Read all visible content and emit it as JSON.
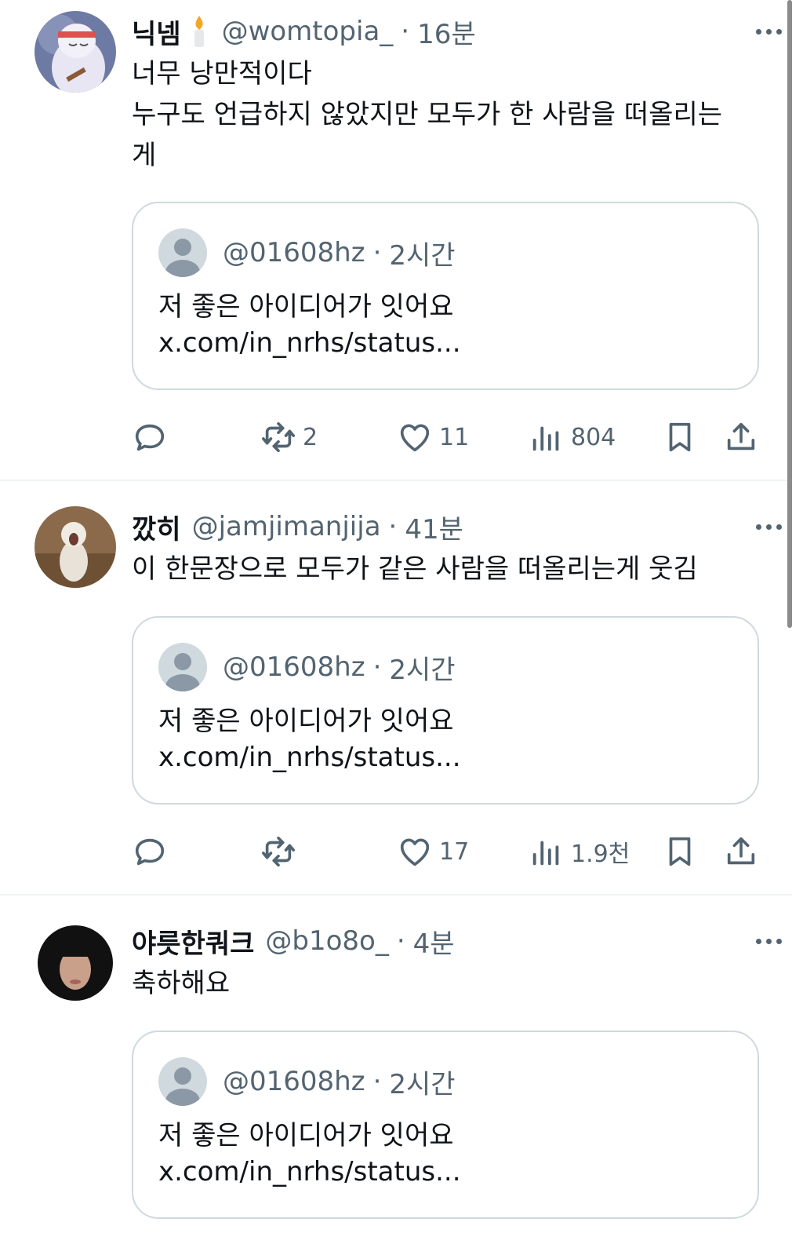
{
  "tweets": [
    {
      "name": "닉넴",
      "handle": "@womtopia_",
      "time": "16분",
      "text_lines": [
        "너무 낭만적이다",
        "누구도 언급하지 않았지만 모두가 한 사람을 떠올리는",
        "게"
      ],
      "quote": {
        "handle": "@01608hz",
        "time": "2시간",
        "line1": "저 좋은 아이디어가 잇어요",
        "line2": "x.com/in_nrhs/status..."
      },
      "retweets": "2",
      "likes": "11",
      "views": "804"
    },
    {
      "name": "깠히",
      "handle": "@jamjimanjija",
      "time": "41분",
      "text_lines": [
        "이 한문장으로 모두가 같은 사람을 떠올리는게 웃김"
      ],
      "quote": {
        "handle": "@01608hz",
        "time": "2시간",
        "line1": "저 좋은 아이디어가 잇어요",
        "line2": "x.com/in_nrhs/status..."
      },
      "retweets": "",
      "likes": "17",
      "views": "1.9천"
    },
    {
      "name": "야릇한쿼크",
      "handle": "@b1o8o_",
      "time": "4분",
      "text_lines": [
        "축하해요"
      ],
      "quote": {
        "handle": "@01608hz",
        "time": "2시간",
        "line1": "저 좋은 아이디어가 잇어요",
        "line2": "x.com/in_nrhs/status..."
      }
    }
  ],
  "separator": "·",
  "icons": {
    "reply": "reply-icon",
    "retweet": "retweet-icon",
    "like": "heart-icon",
    "views": "views-icon",
    "bookmark": "bookmark-icon",
    "share": "share-icon",
    "more": "more-icon"
  },
  "colors": {
    "text": "#0f1419",
    "muted": "#536471",
    "border": "#cfd9de"
  }
}
